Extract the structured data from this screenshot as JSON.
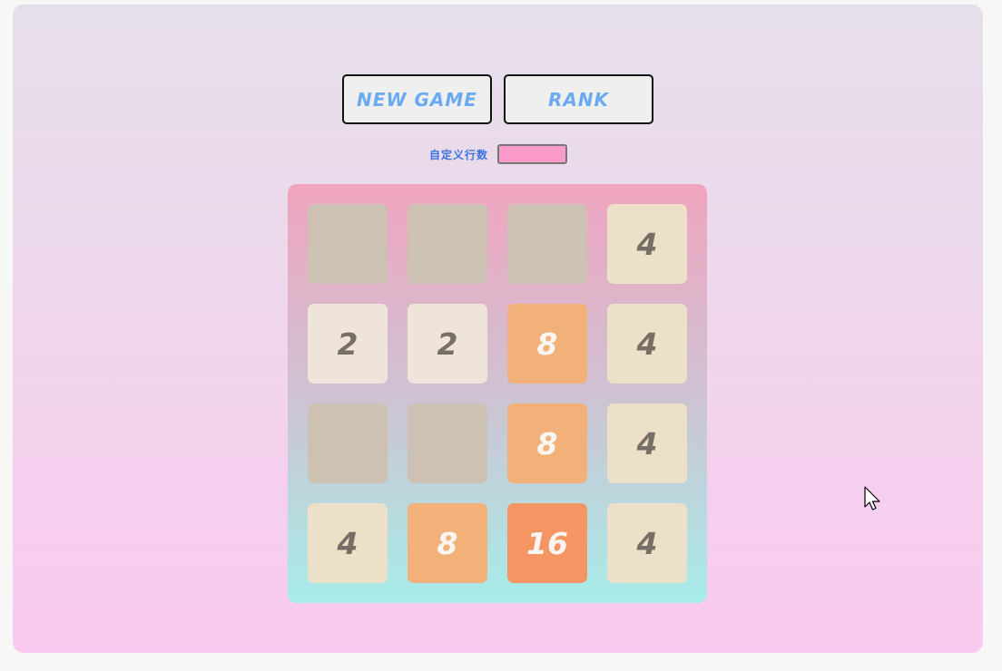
{
  "buttons": {
    "new_game": "NEW GAME",
    "rank": "RANK"
  },
  "custom_rows": {
    "label": "自定义行数",
    "value": ""
  },
  "board": {
    "size": 4,
    "tiles": [
      [
        "",
        "",
        "",
        "4"
      ],
      [
        "2",
        "2",
        "8",
        "4"
      ],
      [
        "",
        "",
        "8",
        "4"
      ],
      [
        "4",
        "8",
        "16",
        "4"
      ]
    ]
  },
  "colors": {
    "empty": "#cdc1b4",
    "2": "#eee4da",
    "4": "#ede0c8",
    "8": "#f2b179",
    "16": "#f59563",
    "dark_text": "#776e65",
    "light_text": "#f9f6f2",
    "button_text": "#6aaaf0"
  }
}
